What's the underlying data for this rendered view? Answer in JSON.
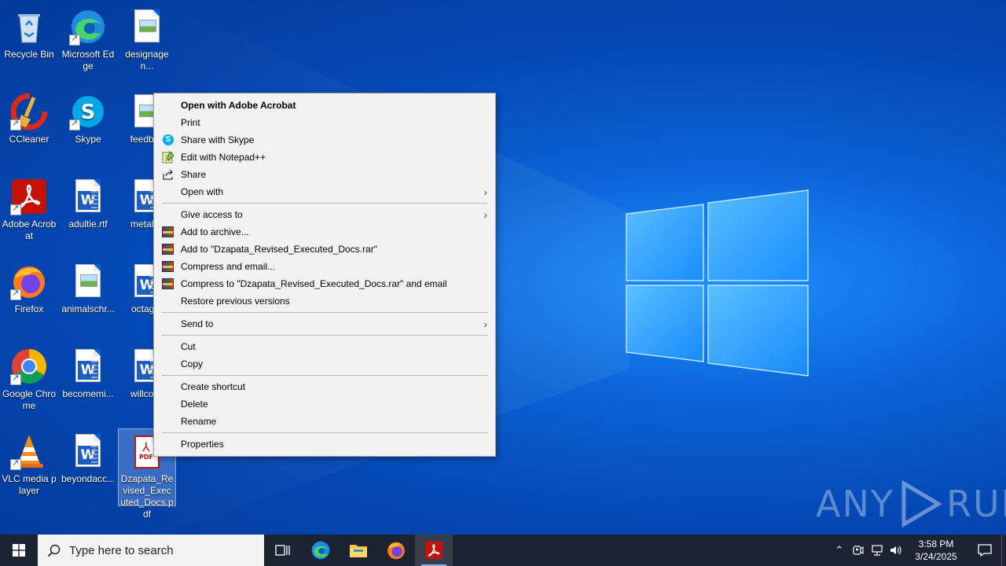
{
  "desktop": {
    "icons": [
      {
        "label": "Recycle Bin",
        "icon": "recycle-bin-icon"
      },
      {
        "label": "Microsoft Edge",
        "icon": "edge-icon"
      },
      {
        "label": "designagen...",
        "icon": "image-file-icon"
      },
      {
        "label": "CCleaner",
        "icon": "ccleaner-icon"
      },
      {
        "label": "Skype",
        "icon": "skype-icon"
      },
      {
        "label": "feedbac",
        "icon": "image-file-icon"
      },
      {
        "label": "Adobe Acrobat",
        "icon": "adobe-acrobat-icon"
      },
      {
        "label": "adultie.rtf",
        "icon": "word-doc-icon"
      },
      {
        "label": "metalsh",
        "icon": "word-doc-icon"
      },
      {
        "label": "Firefox",
        "icon": "firefox-icon"
      },
      {
        "label": "animalschr...",
        "icon": "image-file-icon"
      },
      {
        "label": "octagre",
        "icon": "word-doc-icon"
      },
      {
        "label": "Google Chrome",
        "icon": "chrome-icon"
      },
      {
        "label": "becomemi...",
        "icon": "word-doc-icon"
      },
      {
        "label": "willcopy",
        "icon": "word-doc-icon"
      },
      {
        "label": "VLC media player",
        "icon": "vlc-icon"
      },
      {
        "label": "beyondacc...",
        "icon": "word-doc-icon"
      },
      {
        "label": "Dzapata_Revised_Executed_Docs.pdf",
        "icon": "pdf-file-icon"
      }
    ]
  },
  "context_menu": {
    "items": [
      {
        "label": "Open with Adobe Acrobat"
      },
      {
        "label": "Print"
      },
      {
        "label": "Share with Skype",
        "icon": "skype-icon"
      },
      {
        "label": "Edit with Notepad++",
        "icon": "notepadpp-icon"
      },
      {
        "label": "Share",
        "icon": "share-icon"
      },
      {
        "label": "Open with"
      },
      {
        "label": "Give access to"
      },
      {
        "label": "Add to archive...",
        "icon": "winrar-icon"
      },
      {
        "label": "Add to \"Dzapata_Revised_Executed_Docs.rar\"",
        "icon": "winrar-icon"
      },
      {
        "label": "Compress and email...",
        "icon": "winrar-icon"
      },
      {
        "label": "Compress to \"Dzapata_Revised_Executed_Docs.rar\" and email",
        "icon": "winrar-icon"
      },
      {
        "label": "Restore previous versions"
      },
      {
        "label": "Send to"
      },
      {
        "label": "Cut"
      },
      {
        "label": "Copy"
      },
      {
        "label": "Create shortcut"
      },
      {
        "label": "Delete"
      },
      {
        "label": "Rename"
      },
      {
        "label": "Properties"
      }
    ]
  },
  "watermark": {
    "text_left": "ANY",
    "text_right": "RUN"
  },
  "taskbar": {
    "search_placeholder": "Type here to search",
    "apps": [
      "task-view-icon",
      "edge-icon",
      "file-explorer-icon",
      "firefox-icon",
      "adobe-acrobat-icon"
    ],
    "clock_time": "3:58 PM",
    "clock_date": "3/24/2025"
  },
  "colors": {
    "accent": "#0a5fd6",
    "taskbar": "#1c2431",
    "menu_bg": "#f2f2f2"
  }
}
